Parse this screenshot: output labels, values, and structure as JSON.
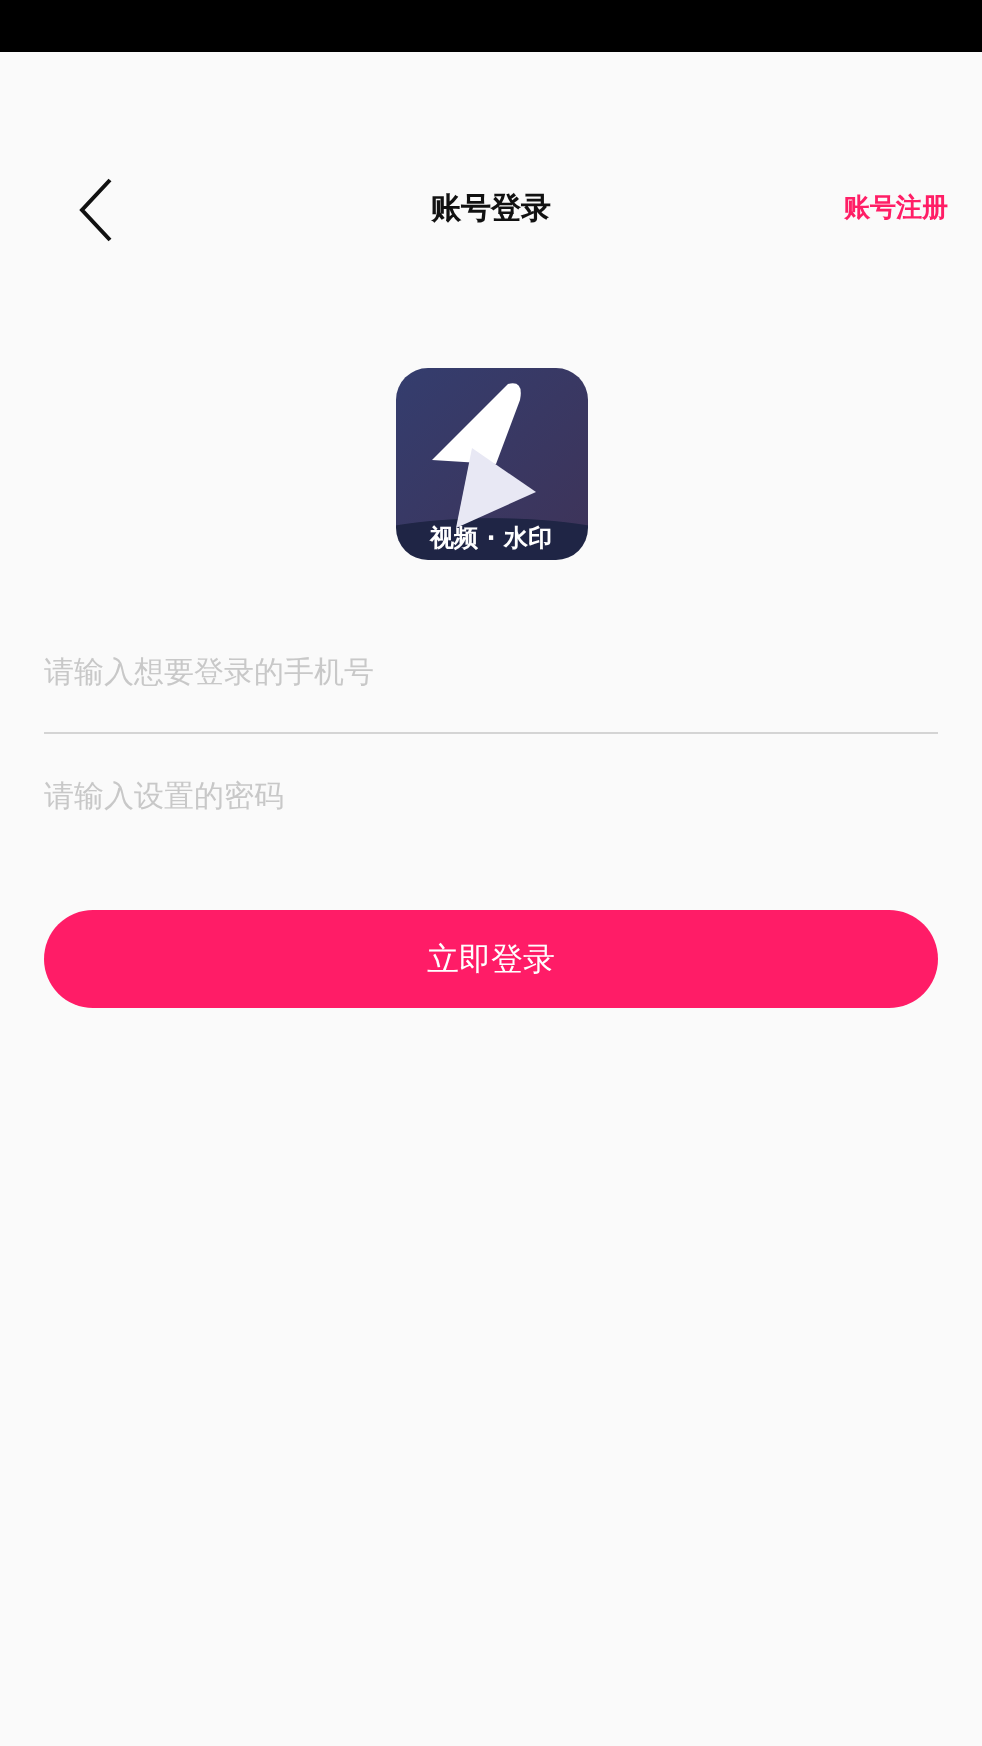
{
  "header": {
    "title": "账号登录",
    "action": "账号注册"
  },
  "logo": {
    "caption": "视频 · 水印"
  },
  "fields": [
    {
      "placeholder": "请输入想要登录的手机号",
      "underlined": true
    },
    {
      "placeholder": "请输入设置的密码",
      "underlined": false
    }
  ],
  "submit": "立即登录"
}
